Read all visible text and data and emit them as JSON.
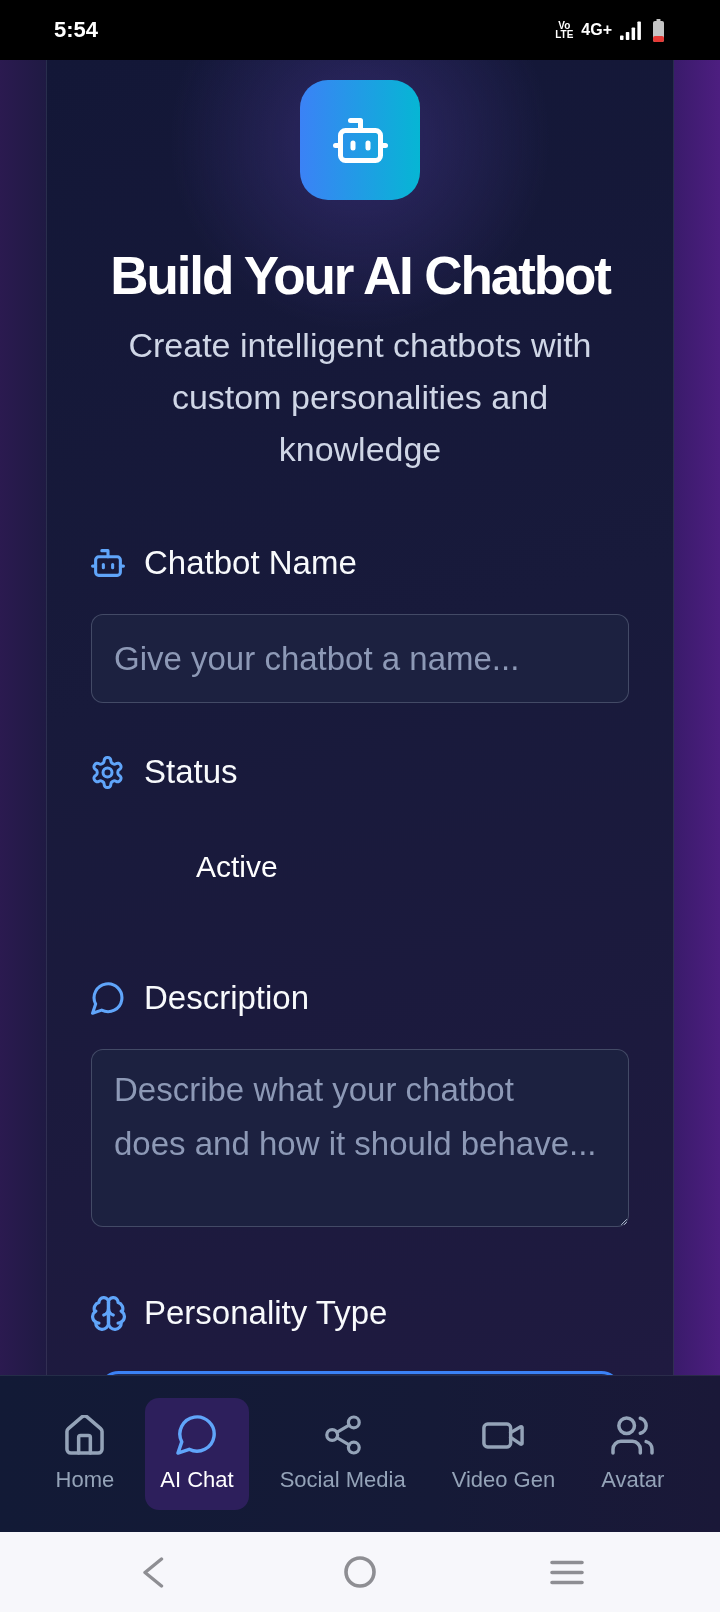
{
  "status_bar": {
    "time": "5:54",
    "volte": {
      "top": "Vo",
      "bottom": "LTE"
    },
    "network": "4G+"
  },
  "header": {
    "title": "Build Your AI Chatbot",
    "subtitle": "Create intelligent chatbots with custom personalities and knowledge"
  },
  "form": {
    "fields": [
      {
        "kind": "input",
        "label": "Chatbot Name",
        "placeholder": "Give your chatbot a name..."
      },
      {
        "kind": "status",
        "label": "Status",
        "value": "Active"
      },
      {
        "kind": "textarea",
        "label": "Description",
        "placeholder": "Describe what your chatbot\ndoes and how it should behave..."
      },
      {
        "kind": "options",
        "label": "Personality Type"
      }
    ]
  },
  "bottom_nav": {
    "items": [
      {
        "label": "Home",
        "selected": false
      },
      {
        "label": "AI Chat",
        "selected": true
      },
      {
        "label": "Social Media",
        "selected": false
      },
      {
        "label": "Video Gen",
        "selected": false
      },
      {
        "label": "Avatar",
        "selected": false
      }
    ]
  }
}
